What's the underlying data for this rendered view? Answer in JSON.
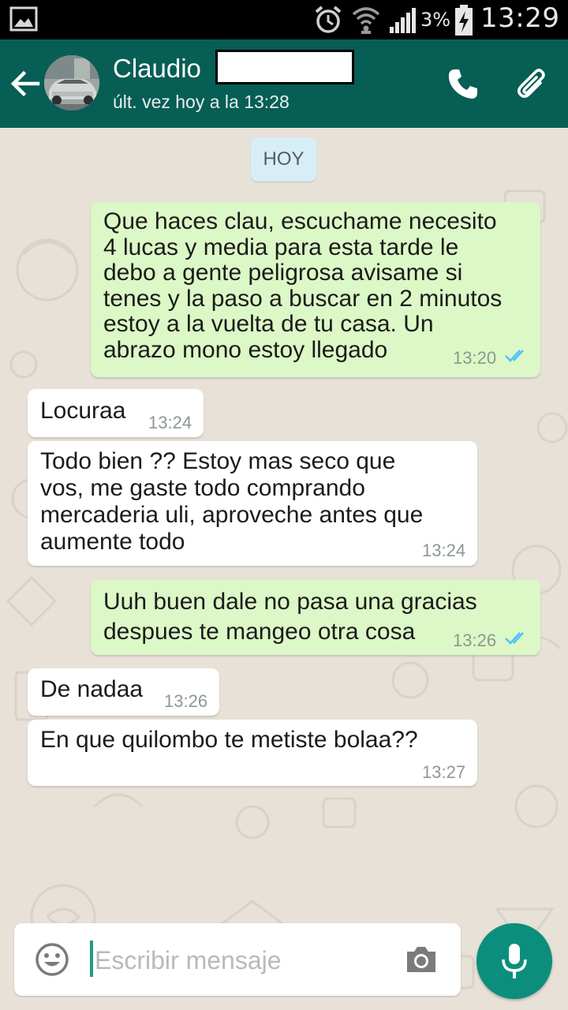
{
  "status_bar": {
    "battery_percent": "3%",
    "time": "13:29",
    "icons": [
      "gallery-icon",
      "alarm-icon",
      "wifi-icon",
      "signal-icon",
      "battery-charging-icon"
    ]
  },
  "header": {
    "contact_name": "Claudio",
    "last_seen": "últ. vez hoy a la 13:28",
    "icons": [
      "back-arrow-icon",
      "phone-icon",
      "paperclip-icon"
    ],
    "background_color": "#075e54"
  },
  "chat": {
    "date_label": "HOY",
    "messages": [
      {
        "direction": "outgoing",
        "text": "Que haces clau, escuchame necesito 4 lucas y media para esta tarde le debo a gente peligrosa avisame si tenes y la paso a buscar en 2 minutos estoy a la vuelta de tu casa. Un abrazo mono estoy llegado",
        "time": "13:20",
        "status": "read"
      },
      {
        "direction": "incoming",
        "text": "Locuraa",
        "time": "13:24"
      },
      {
        "direction": "incoming",
        "text": "Todo bien ?? Estoy mas seco que vos, me gaste todo comprando mercaderia uli, aproveche antes que aumente todo",
        "time": "13:24"
      },
      {
        "direction": "outgoing",
        "text": "Uuh buen dale no pasa una gracias despues te mangeo otra cosa",
        "time": "13:26",
        "status": "read"
      },
      {
        "direction": "incoming",
        "text": "De nadaa",
        "time": "13:26"
      },
      {
        "direction": "incoming",
        "text": "En que quilombo te metiste bolaa??",
        "time": "13:27"
      }
    ],
    "outgoing_bubble_color": "#dcf8c6",
    "incoming_bubble_color": "#ffffff",
    "read_tick_color": "#4fc3f7"
  },
  "composer": {
    "placeholder": "Escribir mensaje",
    "value": "",
    "icons": [
      "emoji-icon",
      "camera-icon",
      "microphone-icon"
    ],
    "accent_color": "#0b8f7c"
  }
}
